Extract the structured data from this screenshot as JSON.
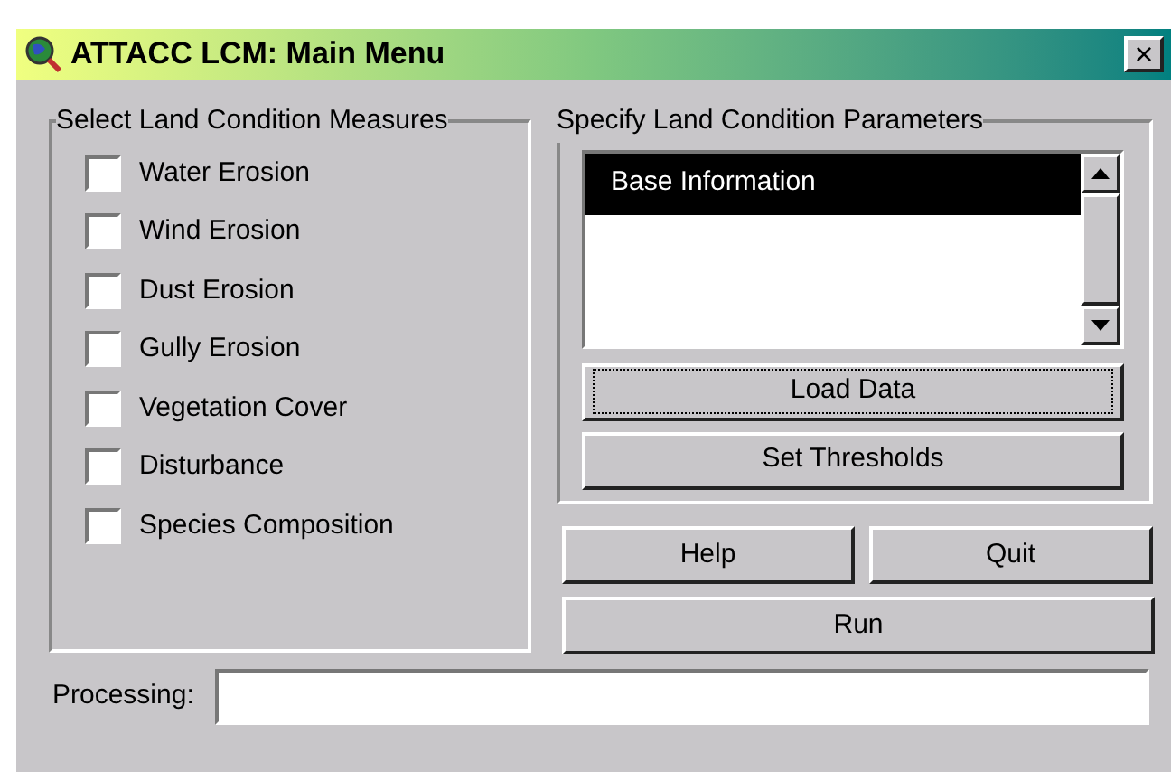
{
  "window": {
    "title": "ATTACC LCM: Main Menu",
    "close": "×"
  },
  "measures": {
    "title": "Select Land Condition Measures",
    "items": [
      {
        "label": "Water Erosion",
        "checked": false
      },
      {
        "label": "Wind Erosion",
        "checked": false
      },
      {
        "label": "Dust Erosion",
        "checked": false
      },
      {
        "label": "Gully Erosion",
        "checked": false
      },
      {
        "label": "Vegetation Cover",
        "checked": false
      },
      {
        "label": "Disturbance",
        "checked": false
      },
      {
        "label": "Species Composition",
        "checked": false
      }
    ]
  },
  "parameters": {
    "title": "Specify Land Condition Parameters",
    "list": [
      {
        "label": "Base Information",
        "selected": true
      }
    ],
    "buttons": [
      {
        "label": "Load Data",
        "focused": true
      },
      {
        "label": "Set Thresholds",
        "focused": false
      }
    ]
  },
  "actions": {
    "help": "Help",
    "quit": "Quit",
    "run": "Run"
  },
  "processing": {
    "label": "Processing:"
  }
}
